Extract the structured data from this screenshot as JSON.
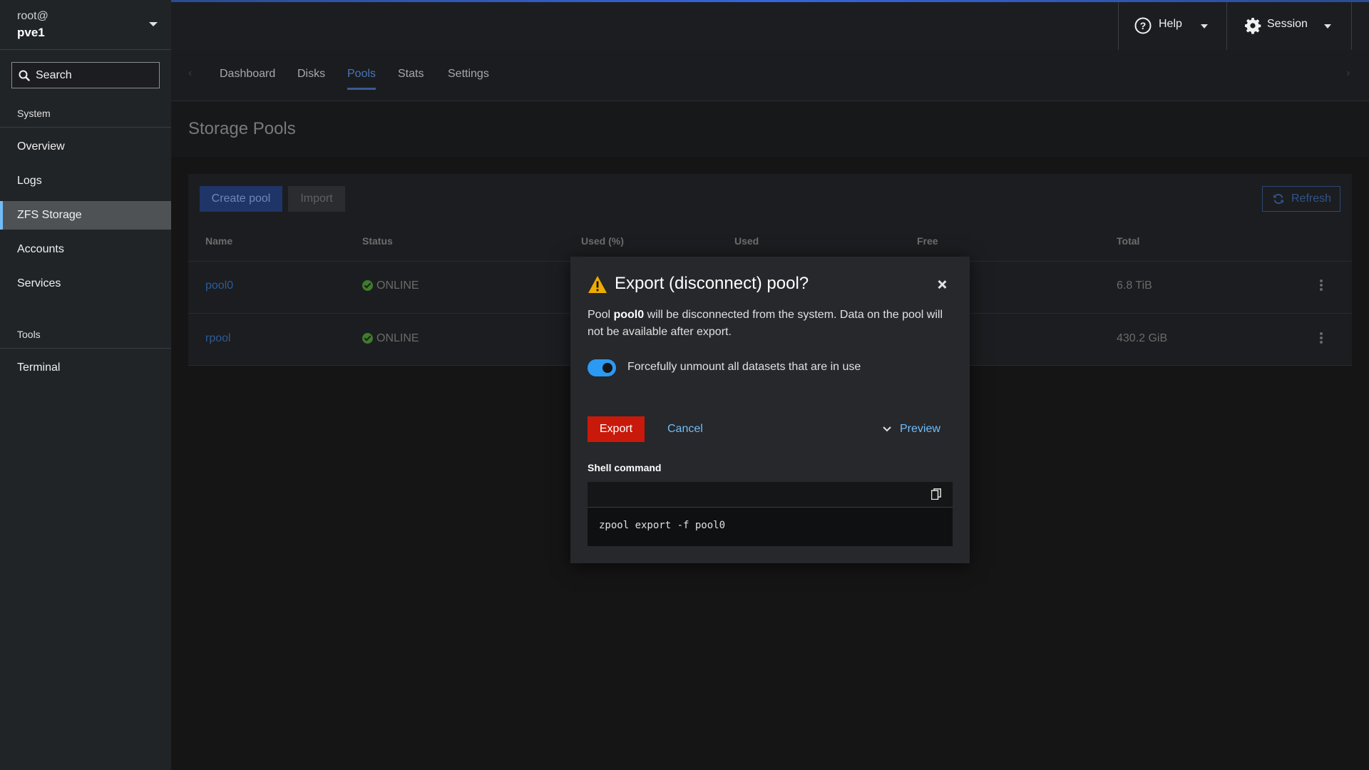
{
  "sidebar": {
    "user": "root@",
    "host": "pve1",
    "search_placeholder": "Search",
    "sections": [
      {
        "title": "System",
        "items": [
          "Overview",
          "Logs",
          "ZFS Storage",
          "Accounts",
          "Services"
        ]
      },
      {
        "title": "Tools",
        "items": [
          "Terminal"
        ]
      }
    ],
    "active_item": "ZFS Storage"
  },
  "topbar": {
    "help_label": "Help",
    "session_label": "Session"
  },
  "tabs": {
    "items": [
      "Dashboard",
      "Disks",
      "Pools",
      "Stats",
      "Settings"
    ],
    "active": "Pools"
  },
  "page": {
    "title": "Storage Pools",
    "create_label": "Create pool",
    "import_label": "Import",
    "refresh_label": "Refresh"
  },
  "table": {
    "headers": [
      "Name",
      "Status",
      "Used (%)",
      "Used",
      "Free",
      "Total"
    ],
    "rows": [
      {
        "name": "pool0",
        "status": "ONLINE",
        "total": "6.8 TiB"
      },
      {
        "name": "rpool",
        "status": "ONLINE",
        "total": "430.2 GiB"
      }
    ]
  },
  "modal": {
    "title": "Export (disconnect) pool?",
    "body_prefix": "Pool ",
    "pool_name": "pool0",
    "body_suffix": " will be disconnected from the system. Data on the pool will not be available after export.",
    "toggle_label": "Forcefully unmount all datasets that are in use",
    "toggle_on": true,
    "export_label": "Export",
    "cancel_label": "Cancel",
    "preview_label": "Preview",
    "shell_label": "Shell command",
    "command": "zpool export -f pool0"
  },
  "colors": {
    "accent": "#73bcf7",
    "danger": "#c9190b",
    "toggle": "#2b9af3",
    "warning": "#f0ab00"
  }
}
